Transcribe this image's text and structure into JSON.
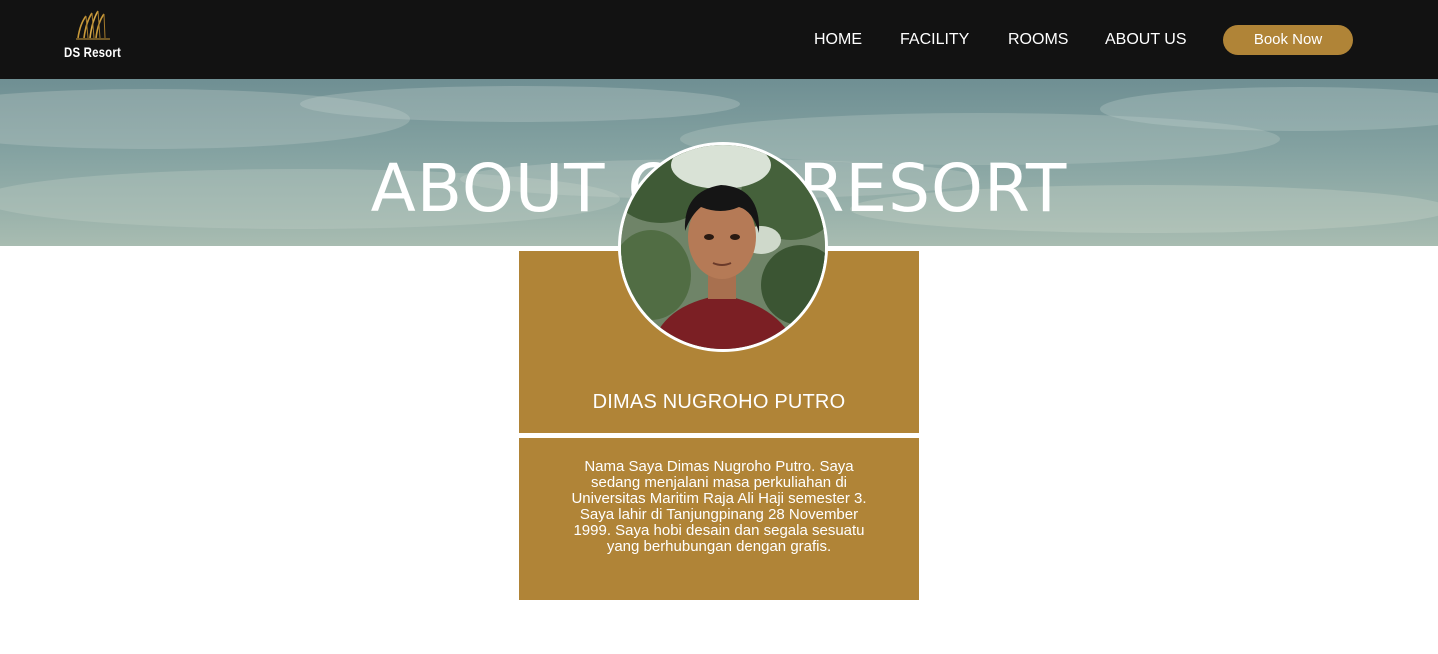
{
  "brand": {
    "name": "DS Resort",
    "accent": "#b08437",
    "nav_bg": "#121212"
  },
  "nav": {
    "items": [
      {
        "label": "HOME"
      },
      {
        "label": "FACILITY"
      },
      {
        "label": "ROOMS"
      },
      {
        "label": "ABOUT US"
      }
    ],
    "cta_label": "Book Now"
  },
  "hero": {
    "title": "ABOUT OUR RESORT"
  },
  "profile": {
    "name": "DIMAS NUGROHO PUTRO",
    "bio": "Nama Saya Dimas Nugroho Putro. Saya sedang menjalani masa perkuliahan di Universitas Maritim Raja Ali Haji semester 3. Saya lahir di Tanjungpinang 28 November 1999. Saya hobi desain dan segala sesuatu yang berhubungan dengan grafis."
  }
}
